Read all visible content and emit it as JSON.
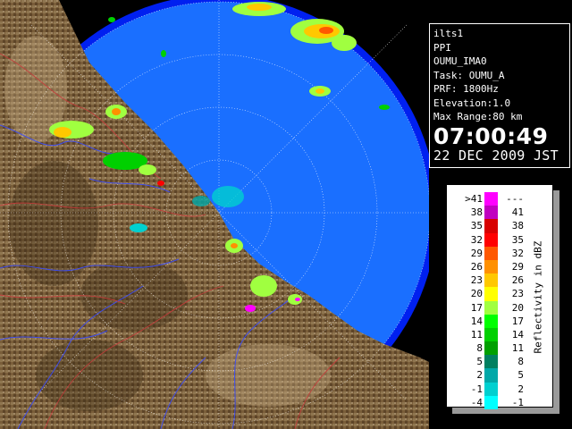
{
  "info": {
    "radar_id": "ilts1",
    "mode": "PPI",
    "product": "OUMU_IMA0",
    "task": "Task: OUMU_A",
    "prf": "PRF: 1800Hz",
    "elevation": "Elevation:1.0",
    "max_range": "Max Range:80 km",
    "time": "07:00:49",
    "date": "22 DEC 2009 JST"
  },
  "colors": {
    "sea_echo_free": "#1a6fff",
    "out_of_range": "#0020f0",
    "land": "#7a5e3a"
  },
  "legend": {
    "title": "Reflectivity in dBZ",
    "rows": [
      {
        "lo": ">41",
        "hi": "---",
        "color": "#ff00ff"
      },
      {
        "lo": "38",
        "hi": "41",
        "color": "#c000c0"
      },
      {
        "lo": "35",
        "hi": "38",
        "color": "#d80000"
      },
      {
        "lo": "32",
        "hi": "35",
        "color": "#ff0000"
      },
      {
        "lo": "29",
        "hi": "32",
        "color": "#ff5800"
      },
      {
        "lo": "26",
        "hi": "29",
        "color": "#ff9000"
      },
      {
        "lo": "23",
        "hi": "26",
        "color": "#ffc800"
      },
      {
        "lo": "20",
        "hi": "23",
        "color": "#ffff00"
      },
      {
        "lo": "17",
        "hi": "20",
        "color": "#a0ff40"
      },
      {
        "lo": "14",
        "hi": "17",
        "color": "#00ff00"
      },
      {
        "lo": "11",
        "hi": "14",
        "color": "#00d000"
      },
      {
        "lo": "8",
        "hi": "11",
        "color": "#00a000"
      },
      {
        "lo": "5",
        "hi": "8",
        "color": "#008060"
      },
      {
        "lo": "2",
        "hi": "5",
        "color": "#00a8a8"
      },
      {
        "lo": "-1",
        "hi": "2",
        "color": "#00d0d0"
      },
      {
        "lo": "-4",
        "hi": "-1",
        "color": "#00ffff"
      }
    ]
  }
}
